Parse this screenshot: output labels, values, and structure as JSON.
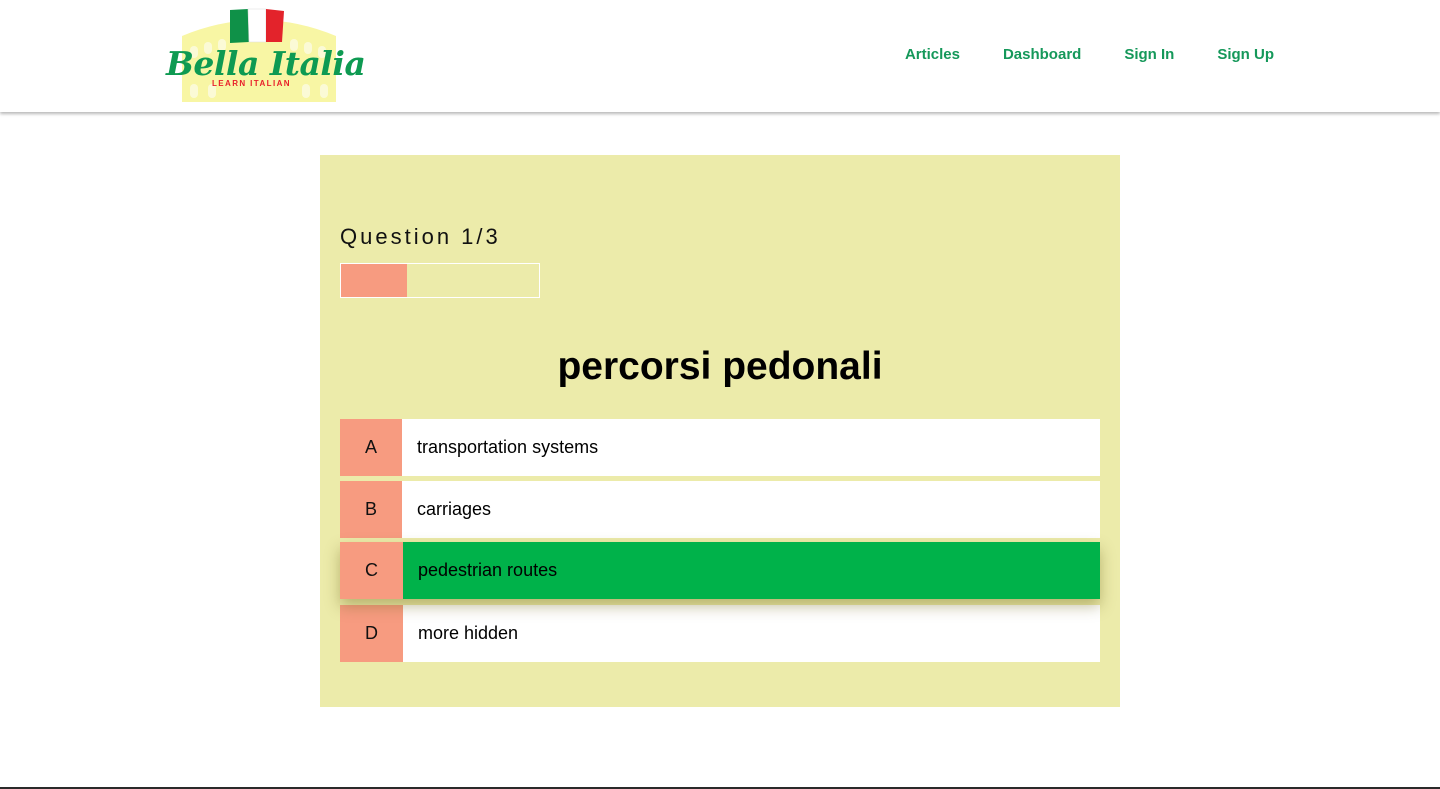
{
  "header": {
    "logo": {
      "title": "Bella Italia",
      "subtitle": "LEARN ITALIAN",
      "flag_colors": [
        "#0f9148",
        "#ffffff",
        "#e3232b"
      ],
      "colosseum_color": "#f7f59a"
    },
    "nav": [
      {
        "label": "Articles"
      },
      {
        "label": "Dashboard"
      },
      {
        "label": "Sign In"
      },
      {
        "label": "Sign Up"
      }
    ]
  },
  "quiz": {
    "counter": "Question 1/3",
    "progress": {
      "current": 1,
      "total": 3
    },
    "prompt": "percorsi pedonali",
    "answers": [
      {
        "letter": "A",
        "text": "transportation systems",
        "state": "default"
      },
      {
        "letter": "B",
        "text": "carriages",
        "state": "default"
      },
      {
        "letter": "C",
        "text": "pedestrian routes",
        "state": "correct"
      },
      {
        "letter": "D",
        "text": "more hidden",
        "state": "default"
      }
    ]
  },
  "colors": {
    "brand_green": "#15985a",
    "card_background": "#ecebaa",
    "letter_badge": "#f79b80",
    "correct_answer": "#00b24a"
  }
}
